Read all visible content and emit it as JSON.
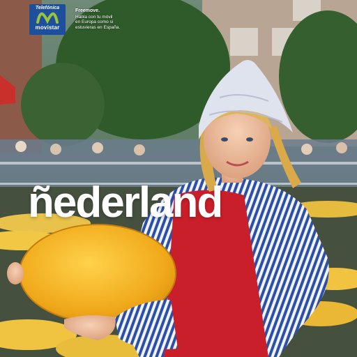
{
  "brand": {
    "top_text": "Telefónica",
    "name": "movistar",
    "mark_color": "#9bc23c",
    "box_color": "#1d4f9c"
  },
  "tagline": {
    "title": "Freemove.",
    "line1": "Habla con tu móvil",
    "line2": "en Europa como si",
    "line3": "estuvieras en España."
  },
  "headline": "ñederland"
}
